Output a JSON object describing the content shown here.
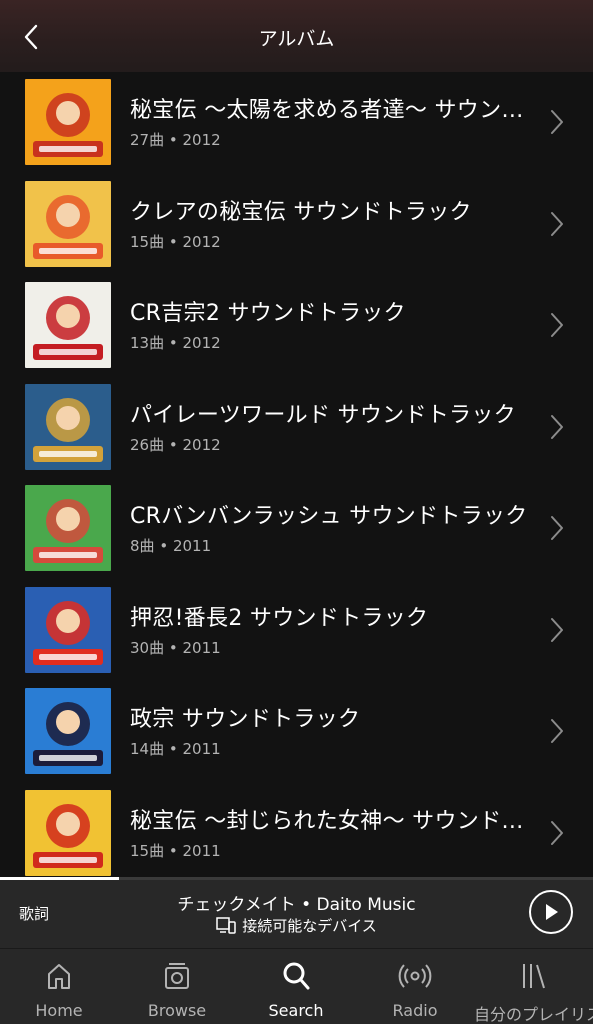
{
  "header": {
    "title": "アルバム",
    "back_icon": "chevron-left-icon"
  },
  "albums": [
    {
      "title": "秘宝伝 〜太陽を求める者達〜 サウンドトラック",
      "tracks": "27曲",
      "year": "2012",
      "art_colors": [
        "#f4a21b",
        "#c8321e"
      ]
    },
    {
      "title": "クレアの秘宝伝 サウンドトラック",
      "tracks": "15曲",
      "year": "2012",
      "art_colors": [
        "#f1c24a",
        "#e85a2a"
      ]
    },
    {
      "title": "CR吉宗2 サウンドトラック",
      "tracks": "13曲",
      "year": "2012",
      "art_colors": [
        "#f0efe9",
        "#c41d22"
      ]
    },
    {
      "title": "パイレーツワールド サウンドトラック",
      "tracks": "26曲",
      "year": "2012",
      "art_colors": [
        "#2b5d8c",
        "#d3a23a"
      ]
    },
    {
      "title": "CRバンバンラッシュ サウンドトラック",
      "tracks": "8曲",
      "year": "2011",
      "art_colors": [
        "#4aa84c",
        "#d54a3c"
      ]
    },
    {
      "title": "押忍!番長2 サウンドトラック",
      "tracks": "30曲",
      "year": "2011",
      "art_colors": [
        "#2a5fb3",
        "#e12d20"
      ]
    },
    {
      "title": "政宗 サウンドトラック",
      "tracks": "14曲",
      "year": "2011",
      "art_colors": [
        "#2a7dd4",
        "#1c1c3a"
      ]
    },
    {
      "title": "秘宝伝 〜封じられた女神〜 サウンドトラック",
      "tracks": "15曲",
      "year": "2011",
      "art_colors": [
        "#f1c233",
        "#d12a1c"
      ]
    }
  ],
  "meta_separator": "•",
  "player": {
    "lyrics_label": "歌詞",
    "track_line": "チェックメイト • Daito Music",
    "device_line": "接続可能なデバイス",
    "device_icon": "devices-icon",
    "play_icon": "play-icon",
    "progress": 0.2
  },
  "tabs": [
    {
      "label": "Home",
      "icon": "home-icon",
      "active": false
    },
    {
      "label": "Browse",
      "icon": "browse-icon",
      "active": false
    },
    {
      "label": "Search",
      "icon": "search-icon",
      "active": true
    },
    {
      "label": "Radio",
      "icon": "radio-icon",
      "active": false
    },
    {
      "label": "自分のプレイリスト",
      "icon": "library-icon",
      "active": false
    }
  ],
  "colors": {
    "background": "#121212",
    "player_bg": "#282828",
    "secondary_text": "#b3b3b3"
  }
}
